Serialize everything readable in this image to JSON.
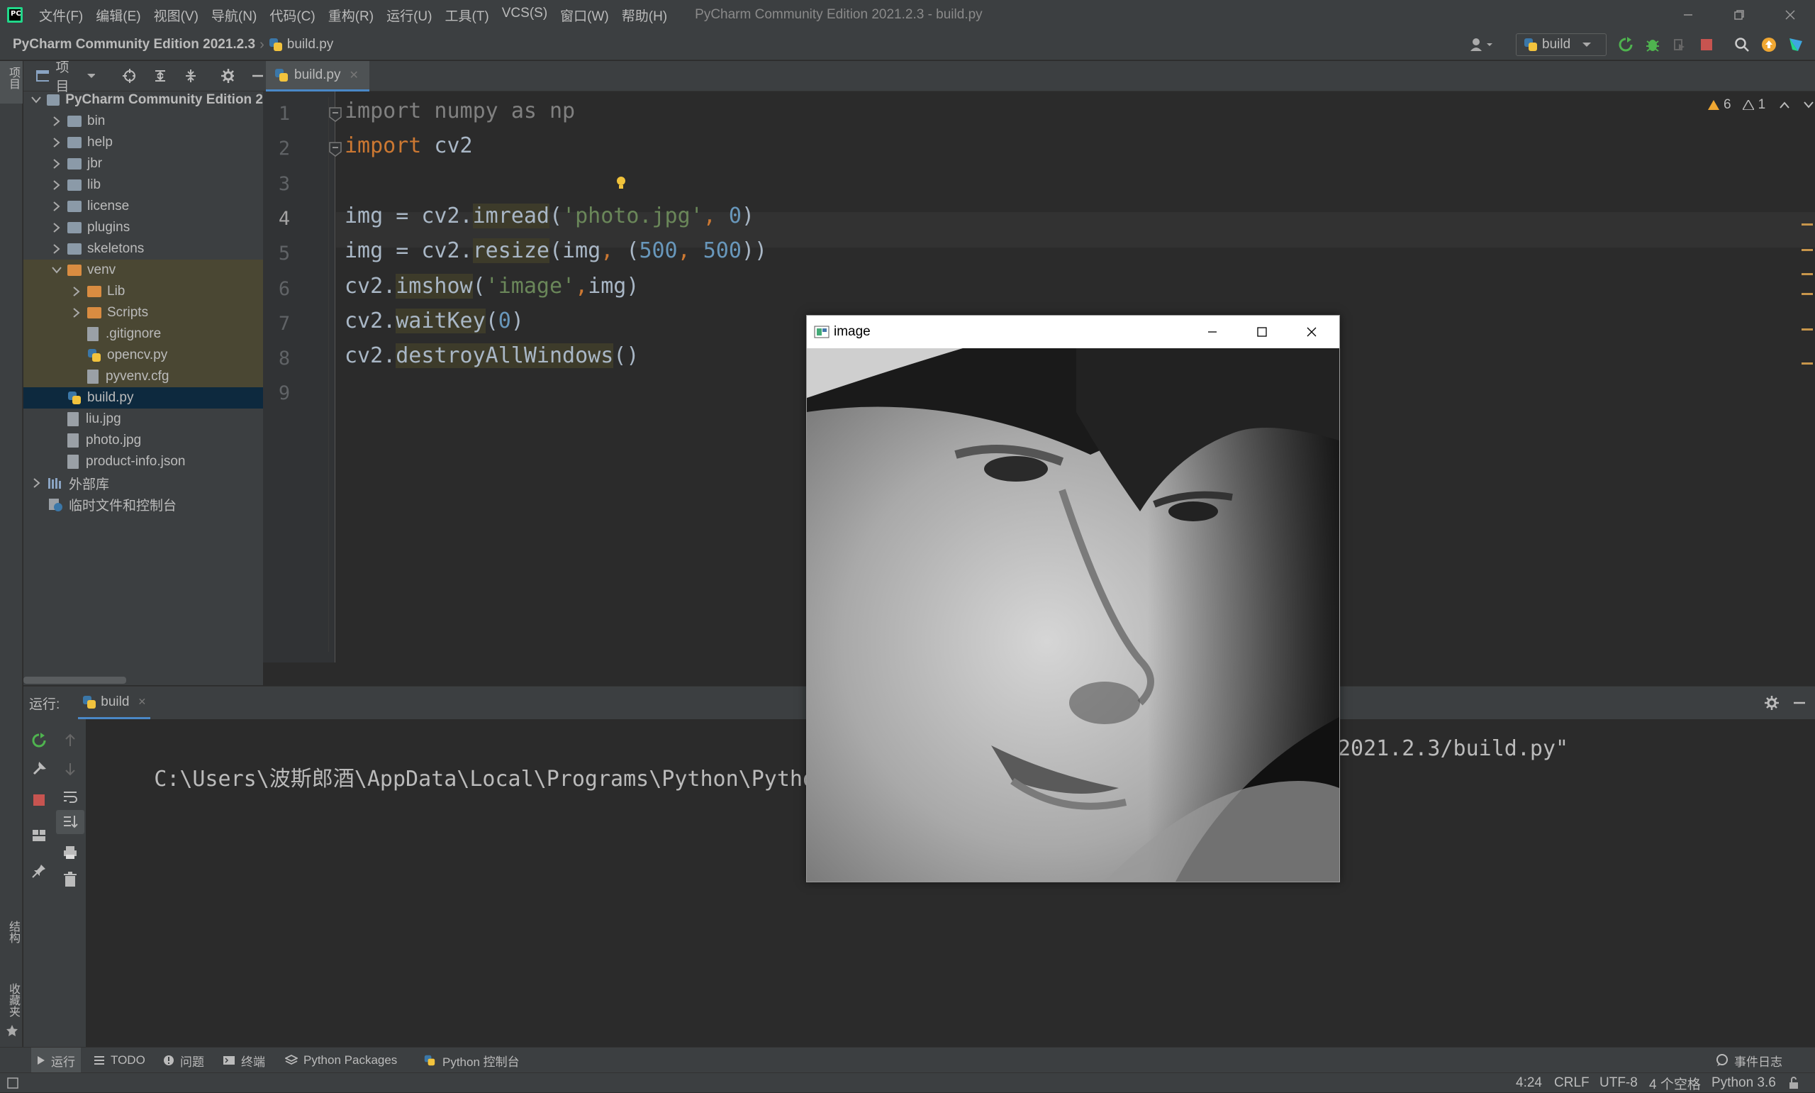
{
  "window": {
    "title": "PyCharm Community Edition 2021.2.3 - build.py",
    "menu": [
      "文件(F)",
      "编辑(E)",
      "视图(V)",
      "导航(N)",
      "代码(C)",
      "重构(R)",
      "运行(U)",
      "工具(T)",
      "VCS(S)",
      "窗口(W)",
      "帮助(H)"
    ]
  },
  "navbar": {
    "project": "PyCharm Community Edition 2021.2.3",
    "file": "build.py",
    "run_config": "build"
  },
  "project_panel": {
    "label": "项目",
    "side_label": "项目",
    "tree": [
      {
        "label": "PyCharm Community Edition 2",
        "depth": 0,
        "kind": "root",
        "expanded": true
      },
      {
        "label": "bin",
        "depth": 1,
        "kind": "folder"
      },
      {
        "label": "help",
        "depth": 1,
        "kind": "folder"
      },
      {
        "label": "jbr",
        "depth": 1,
        "kind": "folder"
      },
      {
        "label": "lib",
        "depth": 1,
        "kind": "folder"
      },
      {
        "label": "license",
        "depth": 1,
        "kind": "folder"
      },
      {
        "label": "plugins",
        "depth": 1,
        "kind": "folder"
      },
      {
        "label": "skeletons",
        "depth": 1,
        "kind": "folder"
      },
      {
        "label": "venv",
        "depth": 1,
        "kind": "venv",
        "expanded": true
      },
      {
        "label": "Lib",
        "depth": 2,
        "kind": "venvfolder"
      },
      {
        "label": "Scripts",
        "depth": 2,
        "kind": "venvfolder"
      },
      {
        "label": ".gitignore",
        "depth": 2,
        "kind": "file"
      },
      {
        "label": "opencv.py",
        "depth": 2,
        "kind": "py"
      },
      {
        "label": "pyvenv.cfg",
        "depth": 2,
        "kind": "file"
      },
      {
        "label": "build.py",
        "depth": 1,
        "kind": "py",
        "selected": true
      },
      {
        "label": "liu.jpg",
        "depth": 1,
        "kind": "file"
      },
      {
        "label": "photo.jpg",
        "depth": 1,
        "kind": "file"
      },
      {
        "label": "product-info.json",
        "depth": 1,
        "kind": "file"
      },
      {
        "label": "外部库",
        "depth": 0,
        "kind": "lib"
      },
      {
        "label": "临时文件和控制台",
        "depth": 0,
        "kind": "scratch"
      }
    ]
  },
  "editor": {
    "tab": "build.py",
    "inspections": {
      "warnings": "6",
      "weak_warnings": "1"
    },
    "line_numbers": [
      "1",
      "2",
      "3",
      "4",
      "5",
      "6",
      "7",
      "8",
      "9"
    ],
    "code_lines": [
      "import numpy as np",
      "import cv2",
      "",
      "img = cv2.imread('photo.jpg', 0)",
      "img = cv2.resize(img, (500, 500))",
      "cv2.imshow('image',img)",
      "cv2.waitKey(0)",
      "cv2.destroyAllWindows()",
      ""
    ]
  },
  "run_panel": {
    "label": "运行:",
    "tab": "build",
    "console_left": "C:\\Users\\波斯郎酒\\AppData\\Local\\Programs\\Python\\Python36\\",
    "console_right": "2021.2.3/build.py\""
  },
  "image_window": {
    "title": "image"
  },
  "left_strip": {
    "structure": "结构",
    "favorites": "收藏夹"
  },
  "bottom_tabs": [
    "运行",
    "TODO",
    "问题",
    "终端",
    "Python Packages",
    "Python 控制台"
  ],
  "event_log": "事件日志",
  "status": {
    "position": "4:24",
    "line_sep": "CRLF",
    "encoding": "UTF-8",
    "indent": "4 个空格",
    "interpreter": "Python 3.6"
  },
  "colors": {
    "background": "#2b2b2b",
    "panel": "#3c3f41",
    "keyword": "#cc7832",
    "string": "#6a8759",
    "number": "#6897bb",
    "selection": "#0d293e",
    "warning": "#f0a732"
  }
}
